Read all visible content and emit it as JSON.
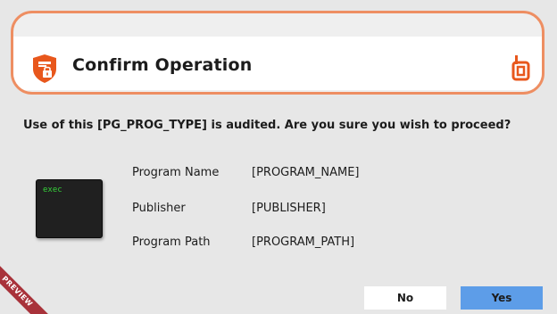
{
  "dialog": {
    "title": "Confirm Operation",
    "question": "Use of this [PG_PROG_TYPE] is audited. Are you sure you wish to proceed?",
    "terminal_text": "exec",
    "details": [
      {
        "label": "Program Name",
        "value": "[PROGRAM_NAME]"
      },
      {
        "label": "Publisher",
        "value": "[PUBLISHER]"
      },
      {
        "label": "Program Path",
        "value": "[PROGRAM_PATH]"
      }
    ],
    "buttons": {
      "no_label": "No",
      "yes_label": "Yes"
    },
    "ribbon_text": "PREVIEW"
  },
  "icons": {
    "header_icon": "shield-lock-icon",
    "brand_icon": "brand-logo-icon",
    "program_icon": "terminal-icon"
  },
  "colors": {
    "accent_orange": "#ee8e62",
    "shield_orange": "#e8571c",
    "yes_button": "#5d9de8",
    "ribbon": "#a8323a",
    "background": "#e7e7e7"
  }
}
